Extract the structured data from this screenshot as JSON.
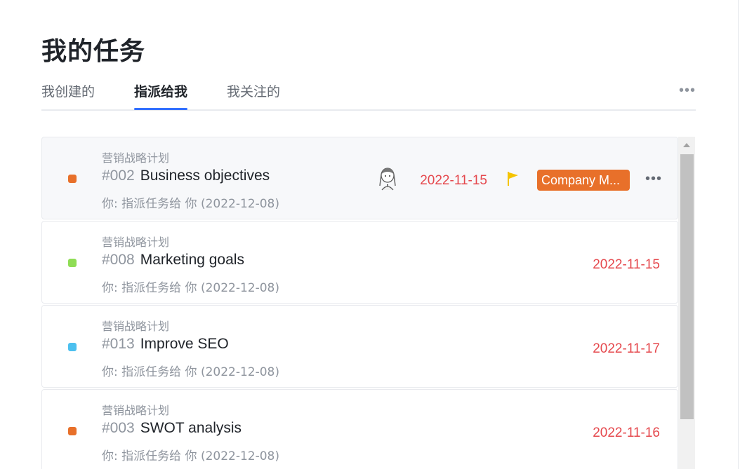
{
  "header": {
    "title": "我的任务"
  },
  "tabs": [
    {
      "label": "我创建的",
      "active": false
    },
    {
      "label": "指派给我",
      "active": true
    },
    {
      "label": "我关注的",
      "active": false
    }
  ],
  "tabs_more": "•••",
  "tasks": [
    {
      "project": "营销战略计划",
      "number": "#002",
      "name": "Business objectives",
      "assigned": "你:  指派任务给 你 (2022-12-08)",
      "date": "2022-11-15",
      "color": "#e8702a",
      "tag": "Company M...",
      "tag_color": "#e8702a",
      "more": "•••"
    },
    {
      "project": "营销战略计划",
      "number": "#008",
      "name": "Marketing goals",
      "assigned": "你:  指派任务给 你 (2022-12-08)",
      "date": "2022-11-15",
      "color": "#8fdd55"
    },
    {
      "project": "营销战略计划",
      "number": "#013",
      "name": "Improve SEO",
      "assigned": "你:  指派任务给 你 (2022-12-08)",
      "date": "2022-11-17",
      "color": "#4cc0ef"
    },
    {
      "project": "营销战略计划",
      "number": "#003",
      "name": "SWOT analysis",
      "assigned": "你:  指派任务给 你 (2022-12-08)",
      "date": "2022-11-16",
      "color": "#e8702a"
    }
  ],
  "colors": {
    "accent": "#3370ff",
    "date_overdue": "#e5484d",
    "flag": "#f5c400"
  }
}
